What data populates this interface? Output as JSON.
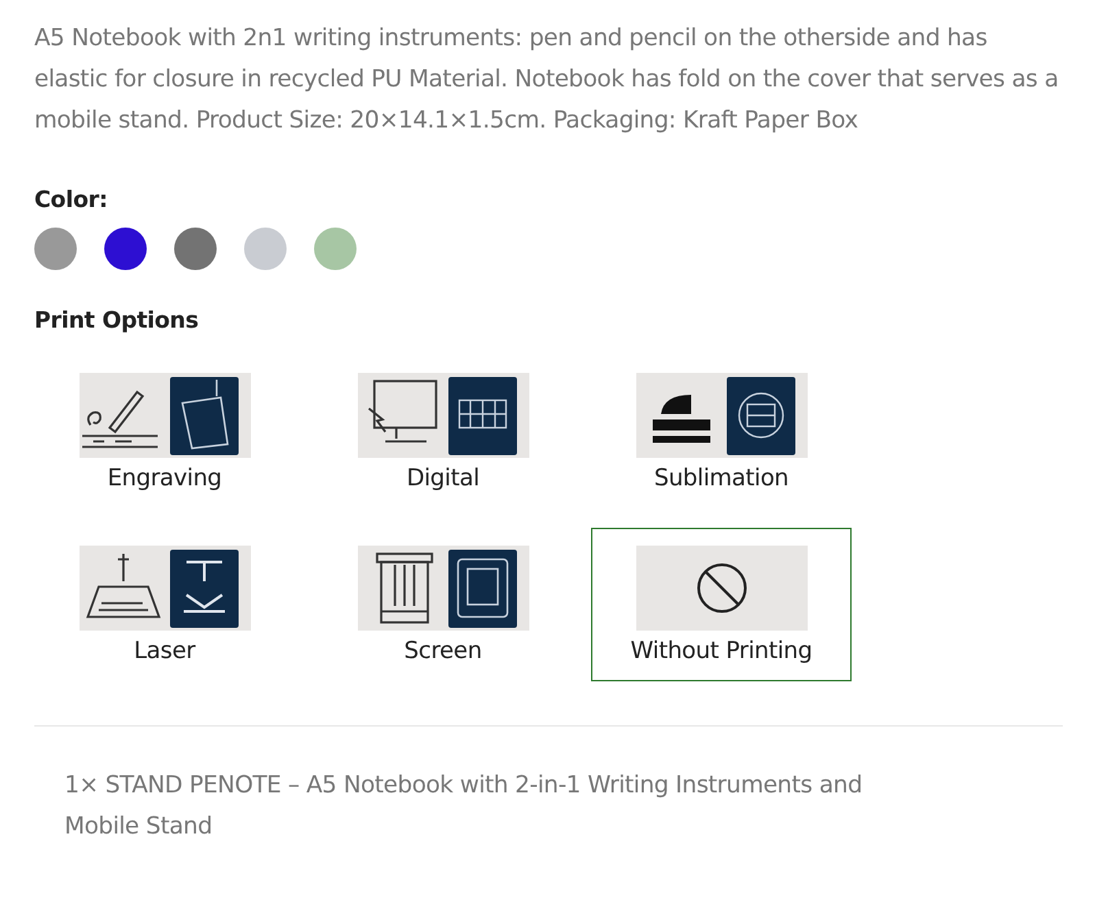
{
  "description": "A5 Notebook with 2n1 writing instruments: pen and pencil on the otherside and has elastic for closure in recycled PU Material. Notebook has fold on the cover that serves as a mobile stand. Product Size: 20×14.1×1.5cm. Packaging: Kraft Paper Box",
  "color_label": "Color:",
  "colors": [
    {
      "color": "#999999"
    },
    {
      "color": "#2d0fd2"
    },
    {
      "color": "#737373"
    },
    {
      "color": "#c9ccd2"
    },
    {
      "color": "#a7c6a4"
    }
  ],
  "print_options_title": "Print Options",
  "print_options": [
    {
      "kind": "engraving",
      "label": "Engraving",
      "selected": false
    },
    {
      "kind": "digital",
      "label": "Digital",
      "selected": false
    },
    {
      "kind": "sublimation",
      "label": "Sublimation",
      "selected": false
    },
    {
      "kind": "laser",
      "label": "Laser",
      "selected": false
    },
    {
      "kind": "screen",
      "label": "Screen",
      "selected": false
    },
    {
      "kind": "none",
      "label": "Without Printing",
      "selected": true
    }
  ],
  "cart_line": "1× STAND PENOTE – A5 Notebook with 2-in-1 Writing Instruments and Mobile Stand"
}
